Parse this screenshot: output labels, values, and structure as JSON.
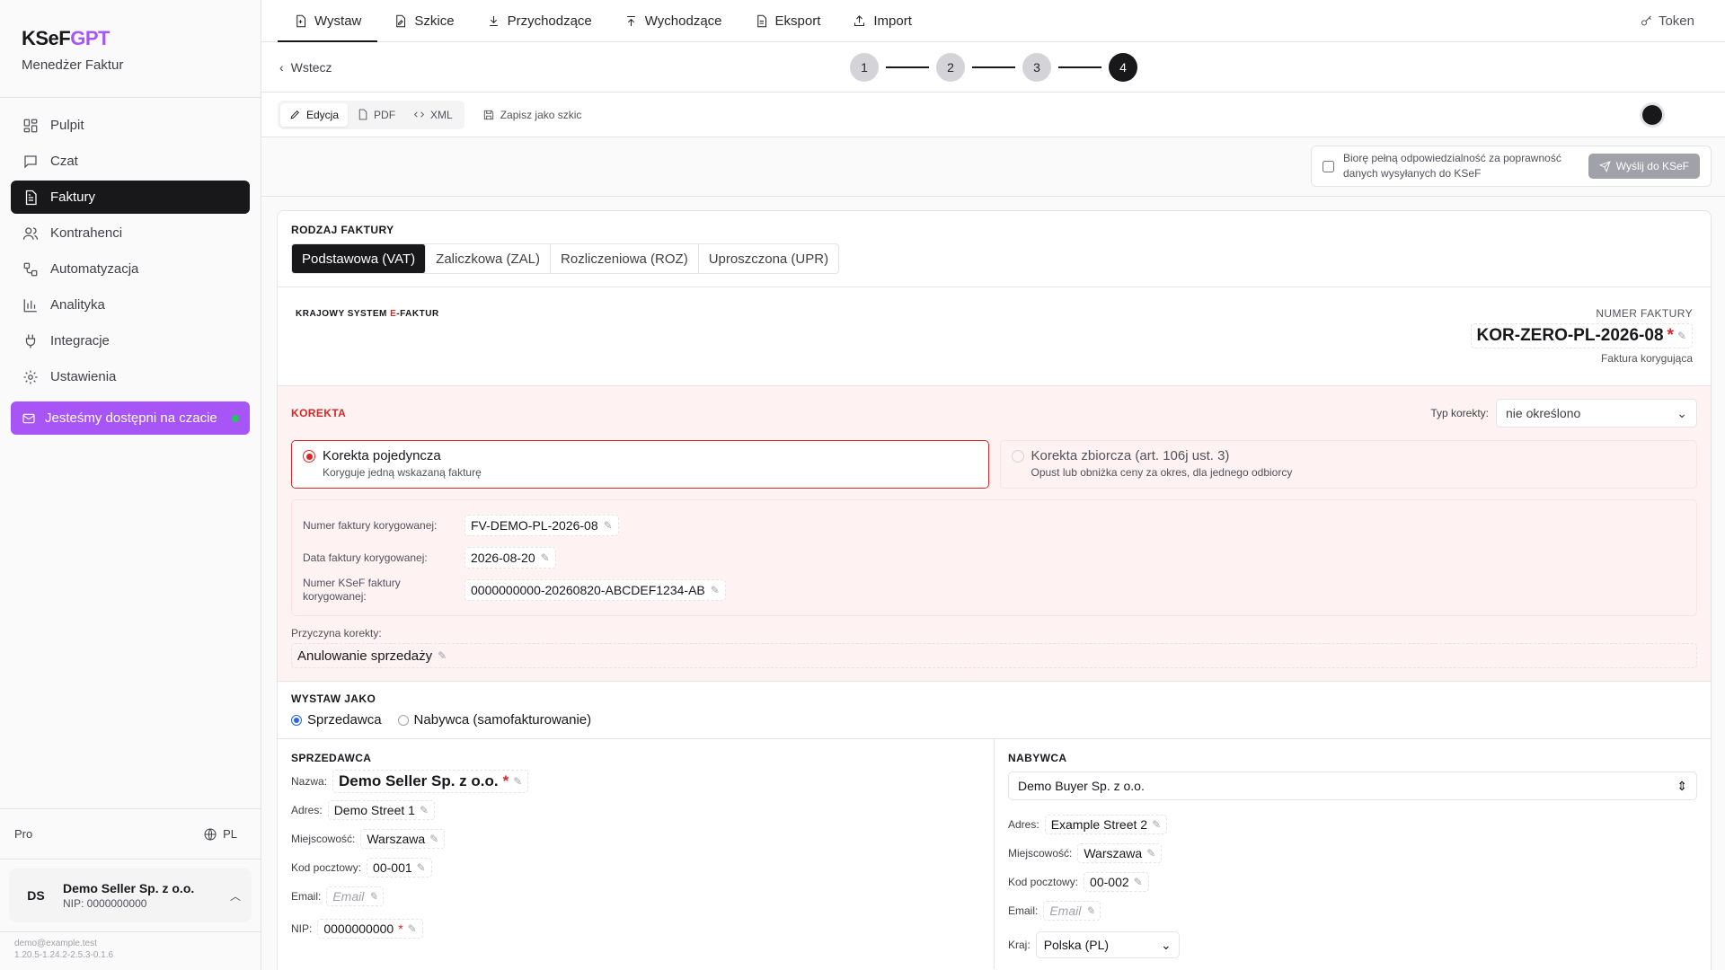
{
  "brand": {
    "name_main": "KSeF",
    "name_accent": "GPT",
    "subtitle": "Menedżer Faktur"
  },
  "nav": [
    {
      "label": "Pulpit",
      "icon": "dashboard-icon",
      "active": false
    },
    {
      "label": "Czat",
      "icon": "chat-icon",
      "active": false
    },
    {
      "label": "Faktury",
      "icon": "invoice-icon",
      "active": true
    },
    {
      "label": "Kontrahenci",
      "icon": "users-icon",
      "active": false
    },
    {
      "label": "Automatyzacja",
      "icon": "workflow-icon",
      "active": false
    },
    {
      "label": "Analityka",
      "icon": "chart-icon",
      "active": false
    },
    {
      "label": "Integracje",
      "icon": "plug-icon",
      "active": false
    },
    {
      "label": "Ustawienia",
      "icon": "gear-icon",
      "active": false
    }
  ],
  "chat_cta": {
    "label": "Jesteśmy dostępni na czacie"
  },
  "plan": {
    "label": "Pro",
    "language": "PL"
  },
  "account": {
    "initials": "DS",
    "name": "Demo Seller Sp. z o.o.",
    "nip": "NIP: 0000000000"
  },
  "footer": {
    "email": "demo@example.test",
    "version": "1.20.5-1.24.2-2.5.3-0.1.6"
  },
  "topnav": {
    "tabs": [
      {
        "label": "Wystaw",
        "icon": "file-plus-icon",
        "active": true
      },
      {
        "label": "Szkice",
        "icon": "draft-icon",
        "active": false
      },
      {
        "label": "Przychodzące",
        "icon": "download-icon",
        "active": false
      },
      {
        "label": "Wychodzące",
        "icon": "upload-icon",
        "active": false
      },
      {
        "label": "Eksport",
        "icon": "export-icon",
        "active": false
      },
      {
        "label": "Import",
        "icon": "import-icon",
        "active": false
      }
    ],
    "token_label": "Token"
  },
  "stepper": {
    "back_label": "Wstecz",
    "steps": [
      "1",
      "2",
      "3",
      "4"
    ],
    "current": 4
  },
  "toolbar": {
    "edit": "Edycja",
    "pdf": "PDF",
    "xml": "XML",
    "save_draft": "Zapisz jako szkic"
  },
  "send": {
    "consent": "Biorę pełną odpowiedzialność za poprawność danych wysyłanych do KSeF",
    "button": "Wyślij do KSeF"
  },
  "invoice_type": {
    "title": "RODZAJ FAKTURY",
    "options": [
      "Podstawowa (VAT)",
      "Zaliczkowa (ZAL)",
      "Rozliczeniowa (ROZ)",
      "Uproszczona (UPR)"
    ],
    "selected": 0
  },
  "header": {
    "logo_pre": "KRAJOWY SYSTEM ",
    "logo_e": "E",
    "logo_post": "-FAKTUR",
    "number_label": "NUMER FAKTURY",
    "number": "KOR-ZERO-PL-2026-08",
    "subtitle": "Faktura korygująca"
  },
  "correction": {
    "title": "KOREKTA",
    "type_label": "Typ korekty:",
    "type_value": "nie określono",
    "options": [
      {
        "title": "Korekta pojedyncza",
        "desc": "Koryguje jedną wskazaną fakturę",
        "selected": true
      },
      {
        "title": "Korekta zbiorcza (art. 106j ust. 3)",
        "desc": "Opust lub obniżka ceny za okres, dla jednego odbiorcy",
        "selected": false
      }
    ],
    "ref_number_label": "Numer faktury korygowanej:",
    "ref_number": "FV-DEMO-PL-2026-08",
    "ref_date_label": "Data faktury korygowanej:",
    "ref_date": "2026-08-20",
    "ref_ksef_label": "Numer KSeF faktury korygowanej:",
    "ref_ksef": "0000000000-20260820-ABCDEF1234-AB",
    "reason_label": "Przyczyna korekty:",
    "reason": "Anulowanie sprzedaży"
  },
  "issue_as": {
    "title": "WYSTAW JAKO",
    "seller": "Sprzedawca",
    "buyer": "Nabywca (samofakturowanie)",
    "selected": "seller"
  },
  "seller": {
    "title": "SPRZEDAWCA",
    "name_label": "Nazwa:",
    "name": "Demo Seller Sp. z o.o.",
    "address_label": "Adres:",
    "address": "Demo Street 1",
    "city_label": "Miejscowość:",
    "city": "Warszawa",
    "postal_label": "Kod pocztowy:",
    "postal": "00-001",
    "email_label": "Email:",
    "email_placeholder": "Email",
    "nip_label": "NIP:",
    "nip": "0000000000"
  },
  "buyer": {
    "title": "NABYWCA",
    "select_value": "Demo Buyer Sp. z o.o.",
    "address_label": "Adres:",
    "address": "Example Street 2",
    "city_label": "Miejscowość:",
    "city": "Warszawa",
    "postal_label": "Kod pocztowy:",
    "postal": "00-002",
    "email_label": "Email:",
    "email_placeholder": "Email",
    "country_label": "Kraj:",
    "country": "Polska (PL)"
  },
  "colors": {
    "accent": "#a855f7",
    "danger": "#dc2626",
    "dark": "#18181b"
  }
}
